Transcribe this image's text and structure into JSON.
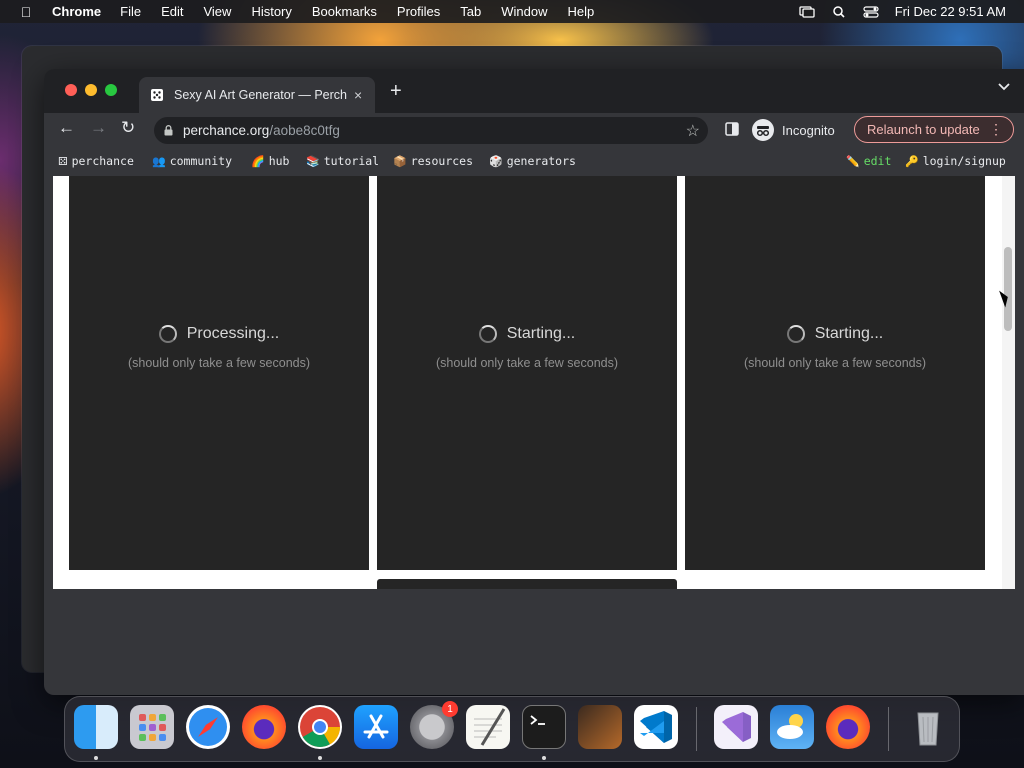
{
  "menubar": {
    "apple_icon": "apple-logo-icon",
    "app_name": "Chrome",
    "menus": [
      "File",
      "Edit",
      "View",
      "History",
      "Bookmarks",
      "Profiles",
      "Tab",
      "Window",
      "Help"
    ],
    "tray": [
      "screen-mirroring-icon",
      "search-icon",
      "control-center-icon"
    ],
    "clock": "Fri Dec 22  9:51 AM"
  },
  "browser": {
    "tab": {
      "title": "Sexy AI Art Generator — Perch",
      "favicon": "perchance-dice-icon",
      "close": "×"
    },
    "new_tab": "+",
    "tab_menu": "chevron-down-icon",
    "nav": {
      "back": "←",
      "forward": "→",
      "reload": "↻"
    },
    "address": {
      "host": "perchance.org",
      "path": "/aobe8c0tfg"
    },
    "incognito_label": "Incognito",
    "relaunch_label": "Relaunch to update",
    "bookmarks": [
      {
        "emoji": "⚄",
        "label": "perchance"
      },
      {
        "emoji": "👥",
        "label": "community"
      },
      {
        "emoji": "🌈",
        "label": "hub"
      },
      {
        "emoji": "📚",
        "label": "tutorial"
      },
      {
        "emoji": "📦",
        "label": "resources"
      },
      {
        "emoji": "🎲",
        "label": "generators"
      }
    ],
    "bookmarks_right": [
      {
        "emoji": "✏️",
        "label": "edit"
      },
      {
        "emoji": "🔑",
        "label": "login/signup"
      }
    ]
  },
  "page": {
    "cards": [
      {
        "status": "Processing...",
        "note": "(should only take a few seconds)"
      },
      {
        "status": "Starting...",
        "note": "(should only take a few seconds)"
      },
      {
        "status": "Starting...",
        "note": "(should only take a few seconds)"
      }
    ]
  },
  "dock": {
    "items": [
      "finder-icon",
      "launchpad-icon",
      "safari-icon",
      "firefox-icon",
      "chrome-icon",
      "app-store-icon",
      "system-settings-icon",
      "textedit-icon",
      "terminal-icon",
      "garageband-icon",
      "vscode-icon",
      "visual-studio-icon",
      "weather-icon",
      "firefox-dev-icon",
      "trash-icon"
    ],
    "settings_badge": "1"
  }
}
